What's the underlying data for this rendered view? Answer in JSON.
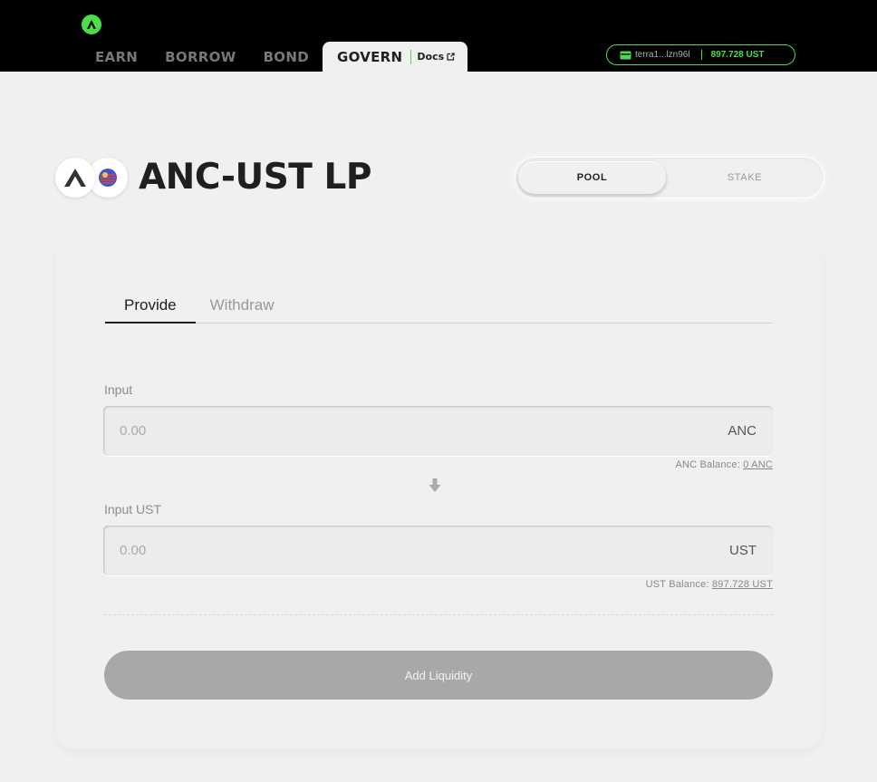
{
  "header": {
    "logo_icon": "anchor-logo-icon",
    "nav": [
      {
        "label": "EARN"
      },
      {
        "label": "BORROW"
      },
      {
        "label": "BOND"
      },
      {
        "label": "GOVERN"
      }
    ],
    "docs_label": "Docs",
    "wallet": {
      "address": "terra1...lzn96l",
      "balance": "897.728 UST"
    },
    "accent_color": "#4bdb4b"
  },
  "title": {
    "text": "ANC-UST LP",
    "icons": [
      "anc-token-icon",
      "ust-token-icon"
    ]
  },
  "toggle": {
    "options": [
      "POOL",
      "STAKE"
    ],
    "selected": "POOL"
  },
  "card": {
    "tabs": [
      "Provide",
      "Withdraw"
    ],
    "selected_tab": "Provide",
    "input1": {
      "label": "Input",
      "placeholder": "0.00",
      "value": "",
      "unit": "ANC",
      "balance_label": "ANC Balance:",
      "balance_value": "0 ANC"
    },
    "input2": {
      "label": "Input UST",
      "placeholder": "0.00",
      "value": "",
      "unit": "UST",
      "balance_label": "UST Balance:",
      "balance_value": "897.728 UST"
    },
    "submit_label": "Add Liquidity"
  }
}
